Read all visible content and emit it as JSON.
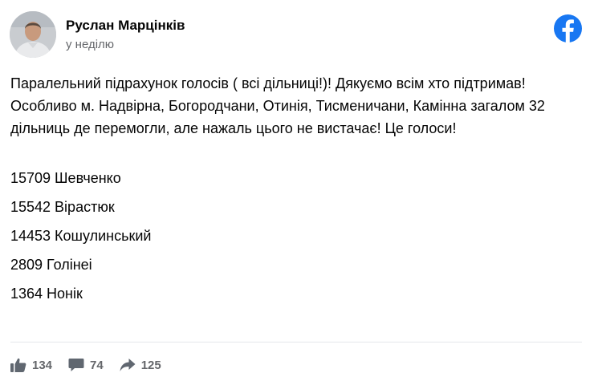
{
  "author": {
    "name": "Руслан Марцінків",
    "time": "у неділю"
  },
  "post": {
    "text": "Паралельний підрахунок голосів ( всі дільниці!)! Дякуємо всім хто підтримав! Особливо м. Надвірна, Богородчани, Отинія, Тисменичани, Камінна загалом 32 дільниць де перемогли, але нажаль цього не вистачає! Це голоси!",
    "results": [
      "15709 Шевченко",
      "15542 Вірастюк",
      "14453 Кошулинський",
      "2809 Голінеі",
      "1364 Нонік"
    ]
  },
  "stats": {
    "likes": "134",
    "comments": "74",
    "shares": "125"
  },
  "icons": {
    "brand": "facebook-icon",
    "like": "thumbs-up-icon",
    "comment": "comment-bubble-icon",
    "share": "share-arrow-icon"
  },
  "colors": {
    "brand": "#1877f2",
    "text": "#050505",
    "secondary": "#65676b",
    "icon": "#606770",
    "divider": "#e4e6eb"
  }
}
